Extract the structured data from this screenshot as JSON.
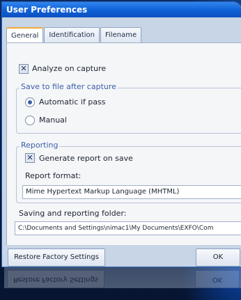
{
  "window": {
    "title": "User Preferences"
  },
  "tabs": [
    {
      "label": "General",
      "active": true
    },
    {
      "label": "Identification",
      "active": false
    },
    {
      "label": "Filename",
      "active": false
    }
  ],
  "general": {
    "analyze_on_capture": {
      "label": "Analyze on capture",
      "checked": true
    },
    "save_group": {
      "legend": "Save to file after capture",
      "options": [
        {
          "label": "Automatic if pass",
          "selected": true
        },
        {
          "label": "Manual",
          "selected": false
        }
      ]
    },
    "reporting_group": {
      "legend": "Reporting",
      "generate_report": {
        "label": "Generate report on save",
        "checked": true
      },
      "format_label": "Report format:",
      "format_value": "Mime Hypertext Markup Language (MHTML)"
    },
    "folder": {
      "label": "Saving and reporting folder:",
      "value": "C:\\Documents and Settings\\nimac1\\My Documents\\EXFO\\Com"
    }
  },
  "footer": {
    "restore_label": "Restore Factory Settings",
    "ok_label": "OK"
  },
  "colors": {
    "titlebar": "#0f5fd6",
    "active_tab_accent": "#f1a63a",
    "group_legend": "#3a5ea8"
  }
}
